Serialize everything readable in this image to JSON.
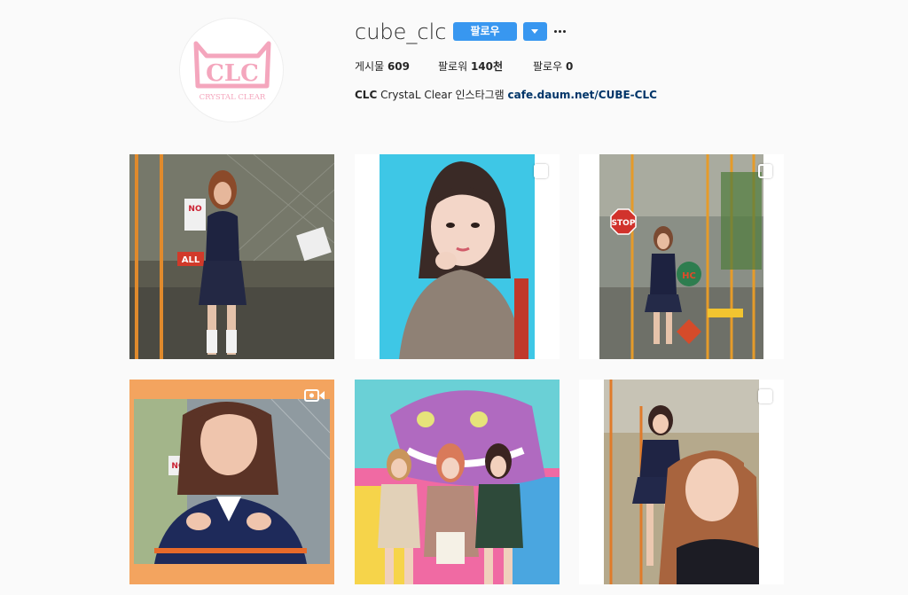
{
  "profile": {
    "username": "cube_clc",
    "follow_label": "팔로우",
    "avatar_text": "CLC",
    "avatar_subtext": "CRYSTAL CLEAR"
  },
  "stats": {
    "posts_label": "게시물",
    "posts_value": "609",
    "followers_label": "팔로워",
    "followers_value": "140천",
    "following_label": "팔로우",
    "following_value": "0"
  },
  "bio": {
    "name": "CLC",
    "text": "CrystaL Clear 인스타그램",
    "link": "cafe.daum.net/CUBE-CLC"
  },
  "posts": [
    {
      "badge": "none"
    },
    {
      "badge": "carousel"
    },
    {
      "badge": "carousel"
    },
    {
      "badge": "video"
    },
    {
      "badge": "none"
    },
    {
      "badge": "carousel"
    }
  ],
  "sign_text": {
    "stop": "STOP",
    "hc": "HC",
    "no": "NO",
    "all": "ALL"
  },
  "colors": {
    "accent": "#3897f0",
    "link": "#003569",
    "logo_pink": "#f4a6bd"
  }
}
